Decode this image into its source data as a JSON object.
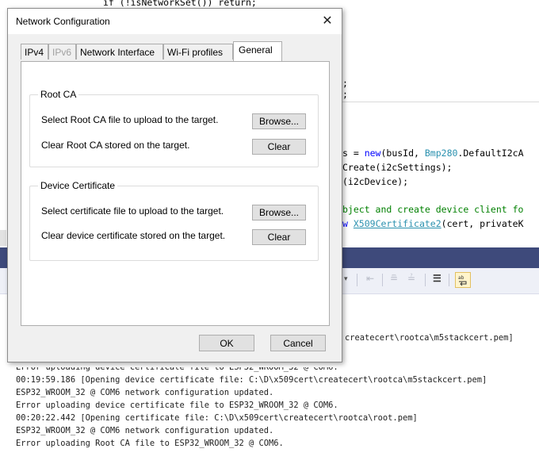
{
  "editor": {
    "top_code": "if (!isNetworkSet()) return;",
    "lines": [
      ";",
      ";",
      "s = new(busId, Bmp280.DefaultI2cA",
      "Create(i2cSettings);",
      "(i2cDevice);",
      "bject and create device client fo",
      "w X509Certificate2(cert, privateK"
    ],
    "bmp_token": "Bmp280",
    "x509_token": "X509Certificate2"
  },
  "output": {
    "first_line_tail": "createcert\\rootca\\m5stackcert.pem]",
    "lines": [
      "Error uploading device certificate file to ESP32_WROOM_32 @ COM6.",
      "00:19:59.186 [Opening device certificate file: C:\\D\\x509cert\\createcert\\rootca\\m5stackcert.pem]",
      "ESP32_WROOM_32 @ COM6 network configuration updated.",
      "Error uploading device certificate file to ESP32_WROOM_32 @ COM6.",
      "00:20:22.442 [Opening certificate file: C:\\D\\x509cert\\createcert\\rootca\\root.pem]",
      "ESP32_WROOM_32 @ COM6 network configuration updated.",
      "Error uploading Root CA file to ESP32_WROOM_32 @ COM6."
    ]
  },
  "dialog": {
    "title": "Network Configuration",
    "close_glyph": "✕",
    "tabs": [
      {
        "label": "IPv4",
        "state": "normal"
      },
      {
        "label": "IPv6",
        "state": "disabled"
      },
      {
        "label": "Network Interface",
        "state": "normal"
      },
      {
        "label": "Wi-Fi profiles",
        "state": "normal"
      },
      {
        "label": "General",
        "state": "active"
      }
    ],
    "root_ca": {
      "title": "Root CA",
      "upload_label": "Select Root CA file to upload to the target.",
      "browse": "Browse...",
      "clear_label": "Clear Root CA stored on the target.",
      "clear": "Clear"
    },
    "device_cert": {
      "title": "Device Certificate",
      "upload_label": "Select certificate file to upload to the target.",
      "browse": "Browse...",
      "clear_label": "Clear device certificate stored on the target.",
      "clear": "Clear"
    },
    "ok": "OK",
    "cancel": "Cancel"
  },
  "colors": {
    "panel_header": "#3e4a7b",
    "keyword": "#0000ff",
    "type": "#2b91af",
    "comment": "#008000"
  }
}
